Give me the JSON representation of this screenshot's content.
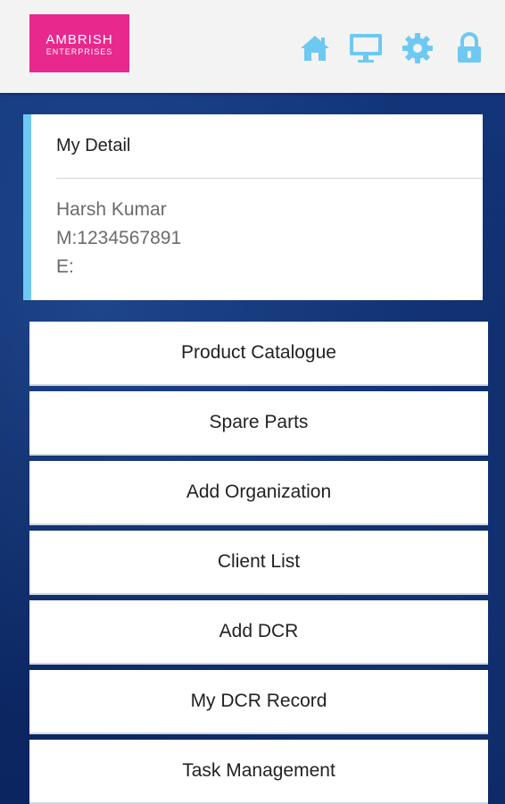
{
  "header": {
    "logo": {
      "line1": "AMBRISH",
      "line2": "ENTERPRISES",
      "color": "#e8288c"
    },
    "icons": [
      {
        "name": "home-icon"
      },
      {
        "name": "monitor-icon"
      },
      {
        "name": "gear-icon"
      },
      {
        "name": "lock-icon"
      }
    ],
    "icon_color": "#6ec9f2"
  },
  "detail": {
    "title": "My Detail",
    "name": "Harsh Kumar",
    "mobile": "M:1234567891",
    "email": "E:",
    "accent": "#6ec9f2"
  },
  "menu": {
    "items": [
      {
        "label": "Product Catalogue"
      },
      {
        "label": "Spare Parts"
      },
      {
        "label": "Add Organization"
      },
      {
        "label": "Client List"
      },
      {
        "label": "Add DCR"
      },
      {
        "label": "My DCR Record"
      },
      {
        "label": "Task Management"
      }
    ]
  },
  "background_color": "#0e2c6b"
}
